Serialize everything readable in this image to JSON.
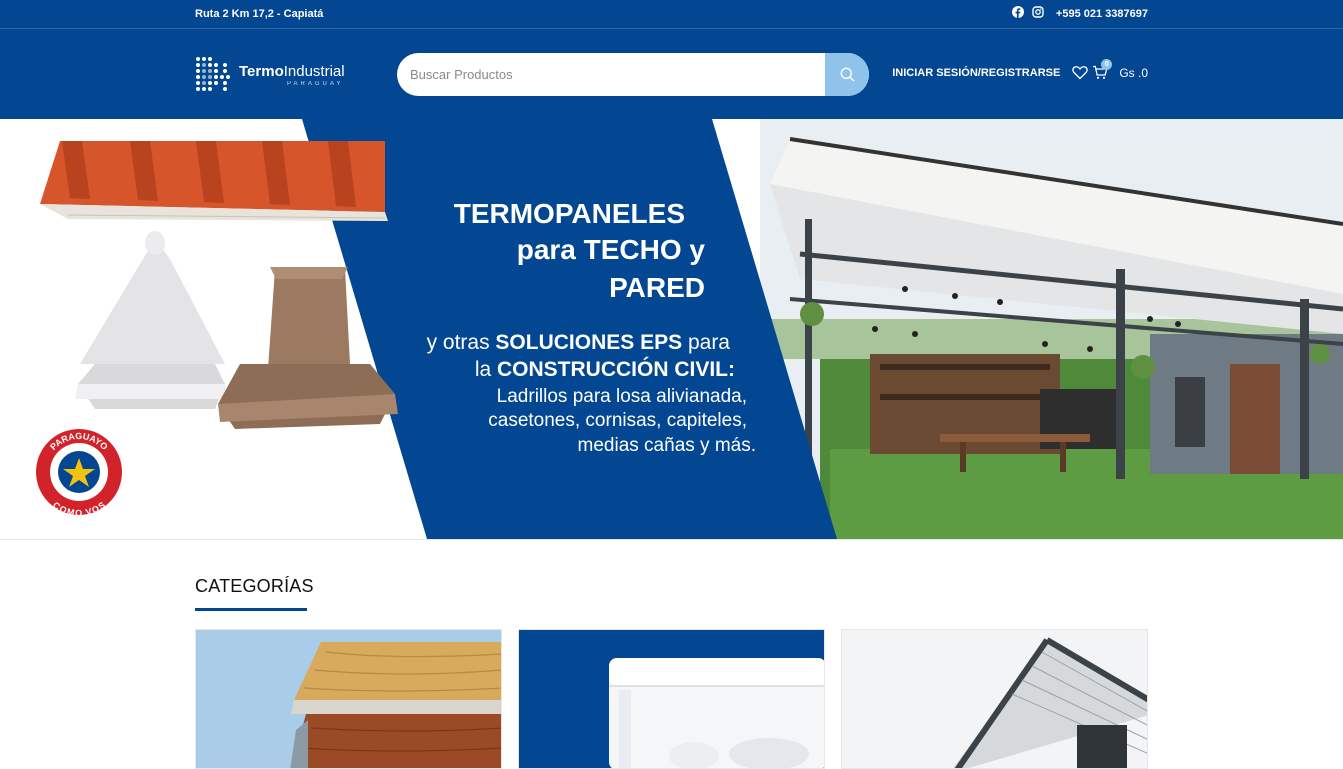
{
  "topbar": {
    "address": "Ruta 2 Km 17,2 - Capiatá",
    "phone": "+595 021 3387697",
    "social_icons": [
      "facebook-icon",
      "instagram-icon"
    ]
  },
  "header": {
    "logo_name_bold": "Termo",
    "logo_name_rest": "Industrial",
    "logo_sub": "PARAGUAY",
    "search_placeholder": "Buscar Productos",
    "login_label": "INICIAR SESIÓN/REGISTRARSE",
    "cart_count": "0",
    "cart_total": "Gs .0"
  },
  "banner": {
    "line1": "TERMOPANELES",
    "line2": "para TECHO y",
    "line3": "PARED",
    "line4_a": "y otras ",
    "line4_b": "SOLUCIONES EPS",
    "line4_c": " para",
    "line5_a": "la ",
    "line5_b": "CONSTRUCCIÓN CIVIL:",
    "line6": "Ladrillos para losa alivianada,",
    "line7": "casetones, cornisas, capiteles,",
    "line8": "medias cañas y más.",
    "badge_top": "PARAGUAYO",
    "badge_bottom": "COMO VOS"
  },
  "categories": {
    "title": "CATEGORÍAS"
  },
  "colors": {
    "brand_blue": "#034691",
    "accent_light_blue": "#8fc3ea",
    "roof_orange": "#d7552a"
  }
}
